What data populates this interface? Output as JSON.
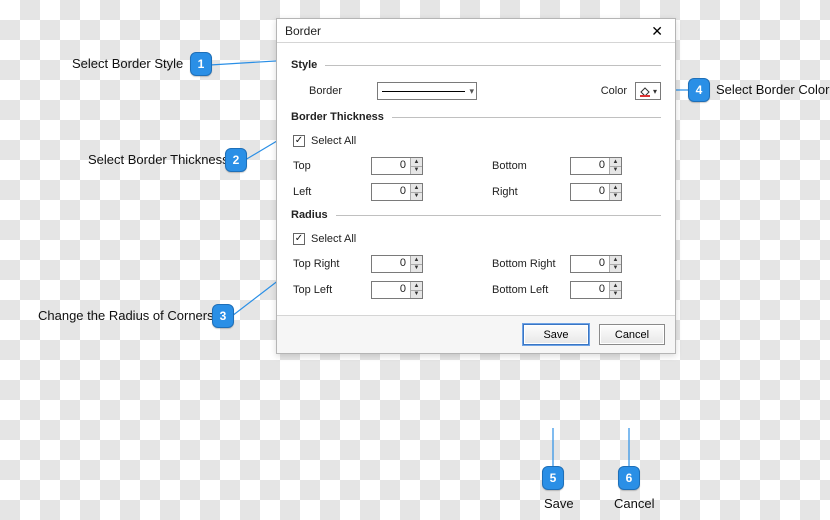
{
  "dialog": {
    "title": "Border",
    "close_glyph": "✕",
    "style": {
      "heading": "Style",
      "border_label": "Border",
      "color_label": "Color"
    },
    "thickness": {
      "heading": "Border Thickness",
      "select_all_label": "Select All",
      "select_all_checked": true,
      "fields": {
        "top": {
          "label": "Top",
          "value": "0"
        },
        "bottom": {
          "label": "Bottom",
          "value": "0"
        },
        "left": {
          "label": "Left",
          "value": "0"
        },
        "right": {
          "label": "Right",
          "value": "0"
        }
      }
    },
    "radius": {
      "heading": "Radius",
      "select_all_label": "Select All",
      "select_all_checked": true,
      "fields": {
        "top_right": {
          "label": "Top Right",
          "value": "0"
        },
        "bottom_right": {
          "label": "Bottom Right",
          "value": "0"
        },
        "top_left": {
          "label": "Top Left",
          "value": "0"
        },
        "bottom_left": {
          "label": "Bottom Left",
          "value": "0"
        }
      }
    },
    "footer": {
      "save_label": "Save",
      "cancel_label": "Cancel"
    }
  },
  "callouts": {
    "c1": {
      "num": "1",
      "text": "Select Border Style"
    },
    "c2": {
      "num": "2",
      "text": "Select Border Thickness"
    },
    "c3": {
      "num": "3",
      "text": "Change the Radius of Corners"
    },
    "c4": {
      "num": "4",
      "text": "Select Border Color"
    },
    "c5": {
      "num": "5",
      "text": "Save"
    },
    "c6": {
      "num": "6",
      "text": "Cancel"
    }
  }
}
